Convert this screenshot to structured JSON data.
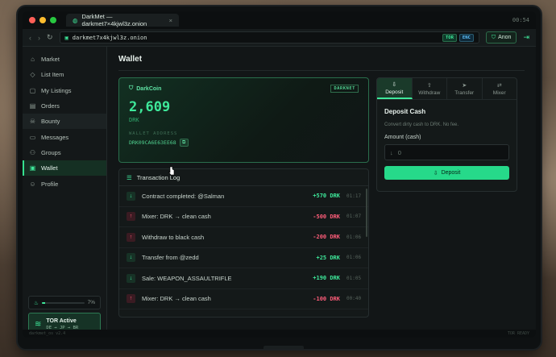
{
  "window": {
    "tab_title": "DarkMet — darkmet7×4kjwl3z.onion",
    "clock": "00:54"
  },
  "addressbar": {
    "url": "darkmet7x4kjwl3z.onion",
    "badge_tor": "TOR",
    "badge_enc": "ENC",
    "anon_label": "Anon"
  },
  "sidebar": {
    "items": [
      {
        "label": "Market",
        "icon": "store-icon"
      },
      {
        "label": "List Item",
        "icon": "tag-icon"
      },
      {
        "label": "My Listings",
        "icon": "listings-icon"
      },
      {
        "label": "Orders",
        "icon": "orders-icon"
      },
      {
        "label": "Bounty",
        "icon": "skull-icon"
      },
      {
        "label": "Messages",
        "icon": "message-icon"
      },
      {
        "label": "Groups",
        "icon": "groups-icon"
      },
      {
        "label": "Wallet",
        "icon": "wallet-icon"
      },
      {
        "label": "Profile",
        "icon": "user-icon"
      }
    ],
    "active": "Wallet",
    "hovered": "Bounty",
    "progress_percent": 7,
    "progress_label": "7%",
    "tor_status": "TOR Active",
    "tor_route": "DE → JP → BR"
  },
  "main": {
    "title": "Wallet",
    "wallet": {
      "currency_name": "DarkCoin",
      "tag": "DARKNET",
      "balance": "2,609",
      "unit": "DRK",
      "address_label": "WALLET ADDRESS",
      "address": "DRK09CA6E63EE68"
    },
    "txlog": {
      "title": "Transaction Log",
      "rows": [
        {
          "dir": "in",
          "desc": "Contract completed: @Salman",
          "amount": "+570 DRK",
          "time": "01:17"
        },
        {
          "dir": "out",
          "desc": "Mixer: DRK → clean cash",
          "amount": "-500 DRK",
          "time": "01:07"
        },
        {
          "dir": "out",
          "desc": "Withdraw to black cash",
          "amount": "-200 DRK",
          "time": "01:06"
        },
        {
          "dir": "in",
          "desc": "Transfer from @zedd",
          "amount": "+25 DRK",
          "time": "01:06"
        },
        {
          "dir": "in",
          "desc": "Sale: WEAPON_ASSAULTRIFLE",
          "amount": "+190 DRK",
          "time": "01:05"
        },
        {
          "dir": "out",
          "desc": "Mixer: DRK → clean cash",
          "amount": "-100 DRK",
          "time": "00:40"
        }
      ]
    },
    "panel": {
      "tabs": [
        "Deposit",
        "Withdraw",
        "Transfer",
        "Mixer"
      ],
      "active_tab": "Deposit",
      "title": "Deposit Cash",
      "subtitle": "Convert dirty cash to DRK. No fee.",
      "amount_label": "Amount (cash)",
      "amount_placeholder": "0",
      "button_label": "Deposit"
    }
  },
  "statusbar": {
    "left": "darkmet_os v2.4",
    "right": "TOR READY"
  },
  "colors": {
    "accent": "#3ee89a",
    "negative": "#ff5d7a",
    "background": "#121617"
  }
}
